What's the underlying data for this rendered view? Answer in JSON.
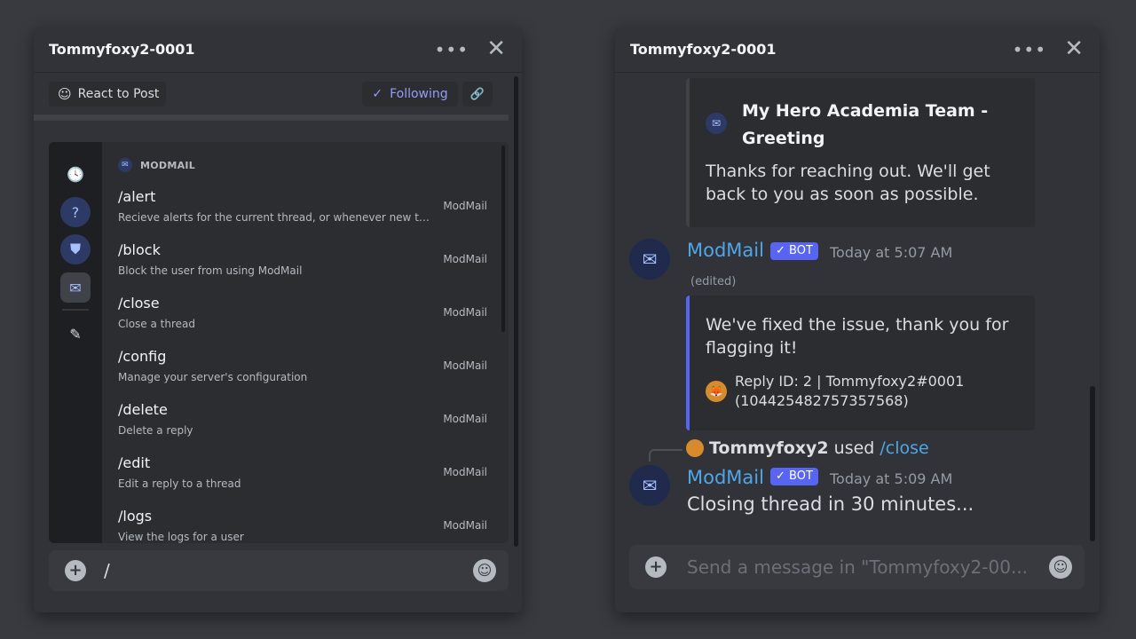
{
  "left": {
    "title": "Tommyfoxy2-0001",
    "more_icon": "more-icon",
    "close_icon": "close-icon",
    "react_to_post": "React to Post",
    "following": "Following",
    "autocomplete": {
      "section": "MODMAIL",
      "commands": [
        {
          "name": "/alert",
          "desc": "Recieve alerts for the current thread, or whenever new thread...",
          "source": "ModMail"
        },
        {
          "name": "/block",
          "desc": "Block the user from using ModMail",
          "source": "ModMail"
        },
        {
          "name": "/close",
          "desc": "Close a thread",
          "source": "ModMail"
        },
        {
          "name": "/config",
          "desc": "Manage your server's configuration",
          "source": "ModMail"
        },
        {
          "name": "/delete",
          "desc": "Delete a reply",
          "source": "ModMail"
        },
        {
          "name": "/edit",
          "desc": "Edit a reply to a thread",
          "source": "ModMail"
        },
        {
          "name": "/logs",
          "desc": "View the logs for a user",
          "source": "ModMail"
        }
      ]
    },
    "input_value": "/"
  },
  "right": {
    "title": "Tommyfoxy2-0001",
    "greet_embed": {
      "title": "My Hero Academia Team - Greeting",
      "body": "Thanks for reaching out. We'll get back to you as soon as possible."
    },
    "message1": {
      "author": "ModMail",
      "tag": "✓ BOT",
      "time": "Today at 5:07 AM",
      "edited": "(edited)"
    },
    "fixed_embed": {
      "body": "We've fixed the issue, thank you for flagging it!",
      "footer": "Reply ID: 2 | Tommyfoxy2#0001 (1044254827573575​68)"
    },
    "system": {
      "user": "Tommyfoxy2",
      "used": "used",
      "command": "/close"
    },
    "message2": {
      "author": "ModMail",
      "tag": "✓ BOT",
      "time": "Today at 5:09 AM",
      "text": "Closing thread in 30 minutes..."
    },
    "input_placeholder": "Send a message in \"Tommyfoxy2-00..."
  },
  "colors": {
    "background": "#383a40",
    "panel": "#313338",
    "accent": "#5865f2",
    "link": "#4ea7e8"
  }
}
